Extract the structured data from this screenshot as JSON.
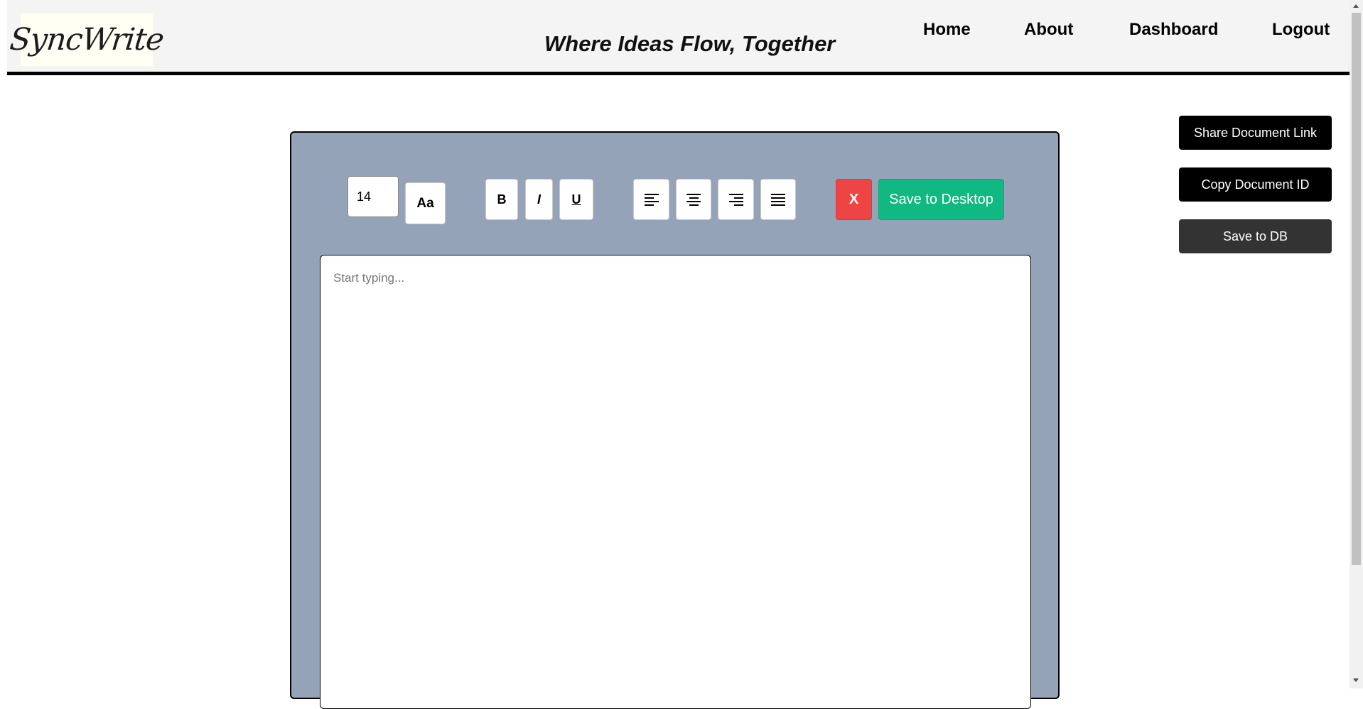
{
  "header": {
    "logo_text": "SyncWrite",
    "tagline": "Where Ideas Flow, Together",
    "nav": {
      "home": "Home",
      "about": "About",
      "dashboard": "Dashboard",
      "logout": "Logout"
    }
  },
  "toolbar": {
    "font_size_value": "14",
    "font_button": "Aa",
    "bold": "B",
    "italic": "I",
    "underline": "U",
    "clear": "X",
    "save_desktop": "Save to Desktop"
  },
  "editor": {
    "placeholder": "Start typing..."
  },
  "side_actions": {
    "share": "Share Document Link",
    "copy": "Copy Document ID",
    "save_db": "Save to DB"
  },
  "icons": {
    "align_left": "align-left-icon",
    "align_center": "align-center-icon",
    "align_right": "align-right-icon",
    "justify": "align-justify-icon"
  },
  "colors": {
    "header_bg": "#f4f4f4",
    "panel_bg": "#95a3b8",
    "clear_button": "#ef4444",
    "save_button": "#10b981",
    "side_button_dark": "#000000",
    "save_db_button": "#333333"
  }
}
